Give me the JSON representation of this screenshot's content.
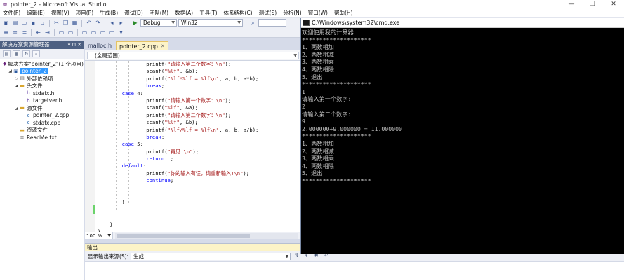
{
  "window": {
    "title": "pointer_2 - Microsoft Visual Studio",
    "controls": [
      "—",
      "❐",
      "✕"
    ]
  },
  "menu": [
    "文件(F)",
    "编辑(E)",
    "视图(V)",
    "项目(P)",
    "生成(B)",
    "调试(D)",
    "团队(M)",
    "数据(A)",
    "工具(T)",
    "体系结构(C)",
    "测试(S)",
    "分析(N)",
    "窗口(W)",
    "帮助(H)"
  ],
  "toolbar": {
    "config": "Debug",
    "platform": "Win32"
  },
  "solution_explorer": {
    "title": "解决方案资源管理器",
    "header_buttons": "▾ ⊓ ✕",
    "items": [
      {
        "label": "解决方案\"pointer_2\"(1 个项目)",
        "icon": "solution-icon",
        "indent": 0,
        "exp": ""
      },
      {
        "label": "pointer_2",
        "icon": "project-icon",
        "indent": 1,
        "exp": "◢",
        "selected": true
      },
      {
        "label": "外部依赖项",
        "icon": "references-icon",
        "indent": 2,
        "exp": "▷"
      },
      {
        "label": "头文件",
        "icon": "folder-icon",
        "indent": 2,
        "exp": "◢"
      },
      {
        "label": "stdafx.h",
        "icon": "header-file-icon",
        "indent": 3,
        "exp": ""
      },
      {
        "label": "targetver.h",
        "icon": "header-file-icon",
        "indent": 3,
        "exp": ""
      },
      {
        "label": "源文件",
        "icon": "folder-icon",
        "indent": 2,
        "exp": "◢"
      },
      {
        "label": "pointer_2.cpp",
        "icon": "cpp-file-icon",
        "indent": 3,
        "exp": ""
      },
      {
        "label": "stdafx.cpp",
        "icon": "cpp-file-icon",
        "indent": 3,
        "exp": ""
      },
      {
        "label": "资源文件",
        "icon": "folder-icon",
        "indent": 2,
        "exp": ""
      },
      {
        "label": "ReadMe.txt",
        "icon": "text-file-icon",
        "indent": 2,
        "exp": ""
      }
    ]
  },
  "editor": {
    "tabs": [
      {
        "label": "malloc.h",
        "active": false
      },
      {
        "label": "pointer_2.cpp",
        "active": true
      }
    ],
    "scope": "(全局范围)",
    "zoom": "100 %",
    "code_lines": [
      [
        {
          "t": "                printf(",
          "c": "fn"
        },
        {
          "t": "\"请输入第二个数字：\\n\"",
          "c": "str"
        },
        {
          "t": ");",
          "c": "fn"
        }
      ],
      [
        {
          "t": "                scanf(",
          "c": "fn"
        },
        {
          "t": "\"%lf\"",
          "c": "str"
        },
        {
          "t": ", &b);",
          "c": "fn"
        }
      ],
      [
        {
          "t": "                printf(",
          "c": "fn"
        },
        {
          "t": "\"%lf*%lf = %lf\\n\"",
          "c": "str"
        },
        {
          "t": ", a, b, a*b);",
          "c": "fn"
        }
      ],
      [
        {
          "t": "                ",
          "c": "fn"
        },
        {
          "t": "break",
          "c": "kw"
        },
        {
          "t": ";",
          "c": "fn"
        }
      ],
      [
        {
          "t": "        ",
          "c": "fn"
        },
        {
          "t": "case",
          "c": "kw"
        },
        {
          "t": " 4:",
          "c": "fn"
        }
      ],
      [
        {
          "t": "                printf(",
          "c": "fn"
        },
        {
          "t": "\"请输入第一个数字：\\n\"",
          "c": "str"
        },
        {
          "t": ");",
          "c": "fn"
        }
      ],
      [
        {
          "t": "                scanf(",
          "c": "fn"
        },
        {
          "t": "\"%lf\"",
          "c": "str"
        },
        {
          "t": ", &a);",
          "c": "fn"
        }
      ],
      [
        {
          "t": "                printf(",
          "c": "fn"
        },
        {
          "t": "\"请输入第二个数字：\\n\"",
          "c": "str"
        },
        {
          "t": ");",
          "c": "fn"
        }
      ],
      [
        {
          "t": "                scanf(",
          "c": "fn"
        },
        {
          "t": "\"%lf\"",
          "c": "str"
        },
        {
          "t": ", &b);",
          "c": "fn"
        }
      ],
      [
        {
          "t": "                printf(",
          "c": "fn"
        },
        {
          "t": "\"%lf/%lf = %lf\\n\"",
          "c": "str"
        },
        {
          "t": ", a, b, a/b);",
          "c": "fn"
        }
      ],
      [
        {
          "t": "                ",
          "c": "fn"
        },
        {
          "t": "break",
          "c": "kw"
        },
        {
          "t": ";",
          "c": "fn"
        }
      ],
      [
        {
          "t": "        ",
          "c": "fn"
        },
        {
          "t": "case",
          "c": "kw"
        },
        {
          "t": " 5:",
          "c": "fn"
        }
      ],
      [
        {
          "t": "                printf(",
          "c": "fn"
        },
        {
          "t": "\"再见!\\n\"",
          "c": "str"
        },
        {
          "t": ");",
          "c": "fn"
        }
      ],
      [
        {
          "t": "                ",
          "c": "fn"
        },
        {
          "t": "return",
          "c": "kw"
        },
        {
          "t": "  ;",
          "c": "fn"
        }
      ],
      [
        {
          "t": "        ",
          "c": "fn"
        },
        {
          "t": "default",
          "c": "kw"
        },
        {
          "t": ":",
          "c": "fn"
        }
      ],
      [
        {
          "t": "                printf(",
          "c": "fn"
        },
        {
          "t": "\"你的输入有误，请重新输入!\\n\"",
          "c": "str"
        },
        {
          "t": ");",
          "c": "fn"
        }
      ],
      [
        {
          "t": "                ",
          "c": "fn"
        },
        {
          "t": "continue",
          "c": "kw"
        },
        {
          "t": ";",
          "c": "fn"
        }
      ],
      [
        {
          "t": "",
          "c": "fn"
        }
      ],
      [
        {
          "t": "",
          "c": "fn"
        }
      ],
      [
        {
          "t": "        }",
          "c": "fn"
        }
      ],
      [
        {
          "t": "",
          "c": "fn"
        }
      ],
      [
        {
          "t": "",
          "c": "fn"
        }
      ],
      [
        {
          "t": "    }",
          "c": "fn"
        }
      ],
      [
        {
          "t": "}",
          "c": "fn"
        }
      ]
    ]
  },
  "output": {
    "title": "输出",
    "source_label": "显示输出来源(S):",
    "source_value": "生成"
  },
  "cmd": {
    "title": "C:\\Windows\\system32\\cmd.exe",
    "lines": [
      "欢迎使用我的计算器",
      "********************",
      "1、两数相加",
      "2、两数相减",
      "3、两数相乘",
      "4、两数相除",
      "5、退出",
      "********************",
      "1",
      "请输入第一个数字:",
      "2",
      "请输入第二个数字:",
      "9",
      "2.000000+9.000000 = 11.000000",
      "********************",
      "1、两数相加",
      "2、两数相减",
      "3、两数相乘",
      "4、两数相除",
      "5、退出",
      "********************"
    ]
  }
}
